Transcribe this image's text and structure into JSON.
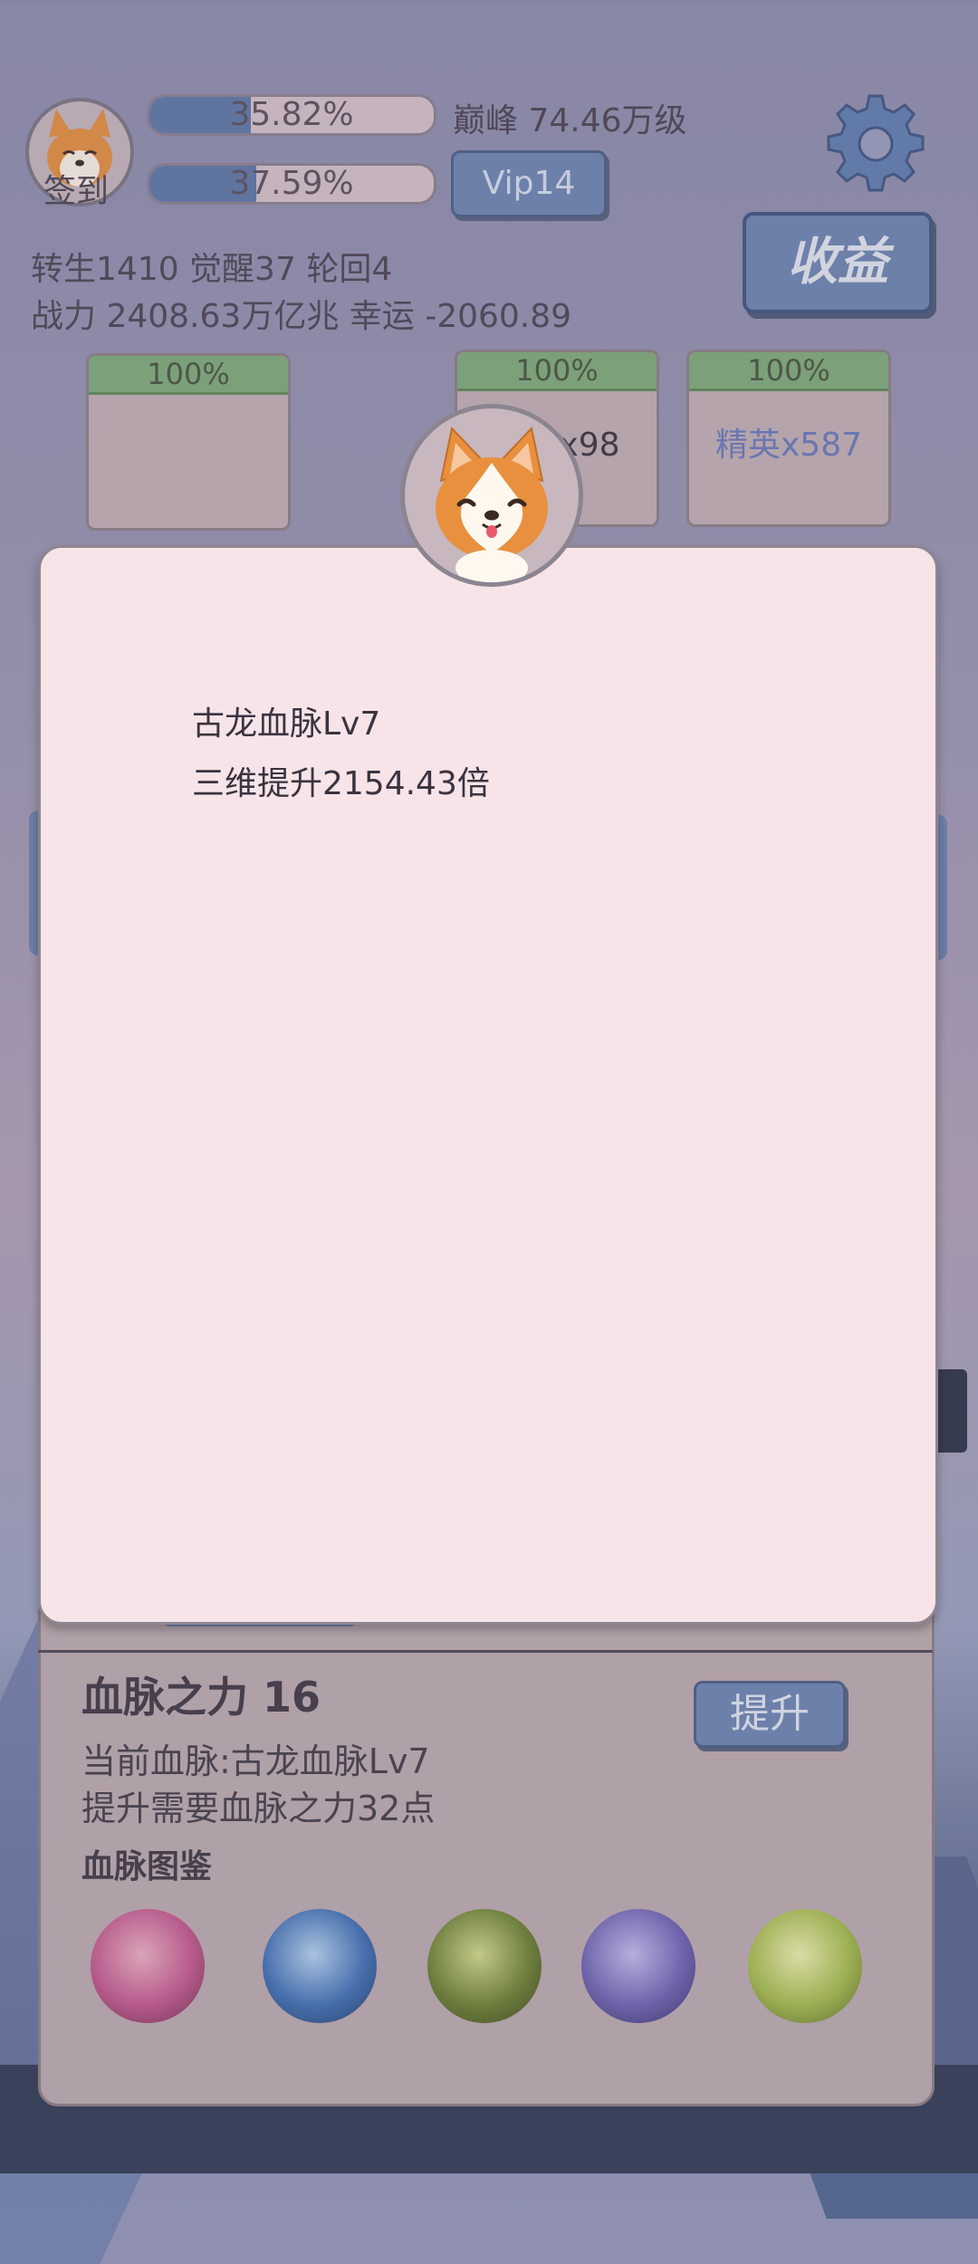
{
  "header": {
    "checkin_label": "签到",
    "bar1_percent": "35.82%",
    "bar1_value": 0.3582,
    "bar2_percent": "37.59%",
    "bar2_value": 0.3759,
    "peak_text": "巅峰 74.46万级",
    "vip_label": "Vip14",
    "income_label": "收益",
    "stats_line1": "转生1410 觉醒37 轮回4",
    "stats_line2": "战力 2408.63万亿兆  幸运 -2060.89"
  },
  "cards": [
    {
      "percent": "100%",
      "label": ""
    },
    {
      "percent": "100%",
      "label": "小怪x98"
    },
    {
      "percent": "100%",
      "label": "精英x587"
    }
  ],
  "dialog": {
    "line1": "古龙血脉Lv7",
    "line2": "三维提升2154.43倍"
  },
  "panel": {
    "title": "血脉之力 16",
    "current": "当前血脉:古龙血脉Lv7",
    "requirement": "提升需要血脉之力32点",
    "upgrade_label": "提升",
    "gallery_title": "血脉图鉴"
  },
  "orbs": [
    {
      "icon": "dragon-orb-icon",
      "color": "#c7588f"
    },
    {
      "icon": "water-spirit-orb-icon",
      "color": "#3e72b8"
    },
    {
      "icon": "forest-spirit-orb-icon",
      "color": "#6d8431"
    },
    {
      "icon": "wolf-orb-icon",
      "color": "#6e64b6"
    },
    {
      "icon": "flame-orb-icon",
      "color": "#a6c04a"
    }
  ],
  "colors": {
    "accent_blue": "#6d87b5",
    "card_green": "#7fae79",
    "dialog_bg": "#f6e4e8"
  }
}
